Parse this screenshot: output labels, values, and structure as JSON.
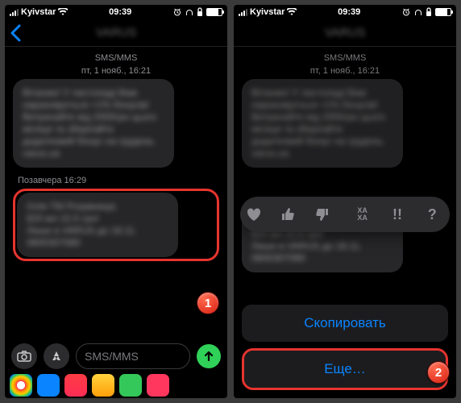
{
  "status": {
    "carrier": "Kyivstar",
    "time": "09:39"
  },
  "nav": {
    "contact_blurred": "VARUS"
  },
  "conversation": {
    "channel_label": "SMS/MMS",
    "header_date": "пт, 1 нояб., 16:21",
    "msg1_blurred": "Вітаємо! У листопаді Вам нараховується +1% бонусів! Витрачайте від 2000грн цього місяця та зберігайте додатковий бонус на грудень.",
    "msg1_link_blurred": "varus.ua",
    "divider_ts": "Позавчера 16:29",
    "msg2_line1_blurred": "Олія ТМ Розумниця,",
    "msg2_line2_blurred": "820 мл   22,5 грн!",
    "msg2_line3_blurred": "Лише в VARUS до 18.11.",
    "msg2_link_blurred": "0800307080"
  },
  "input": {
    "placeholder": "SMS/MMS"
  },
  "reactions": {
    "heart": "heart-icon",
    "thumbs_up": "thumbs-up-icon",
    "thumbs_down": "thumbs-down-icon",
    "haha_label": "XA\nXA",
    "exclaim": "!!",
    "question": "?"
  },
  "sheet": {
    "copy": "Скопировать",
    "more": "Еще…"
  },
  "steps": {
    "one": "1",
    "two": "2"
  },
  "apps": {
    "photos": "#ff2d55",
    "appstore": "#0a84ff",
    "music": "#fc3c44",
    "memoji": "#ffcc00",
    "more1": "#34c759",
    "more2": "#ff375f"
  }
}
